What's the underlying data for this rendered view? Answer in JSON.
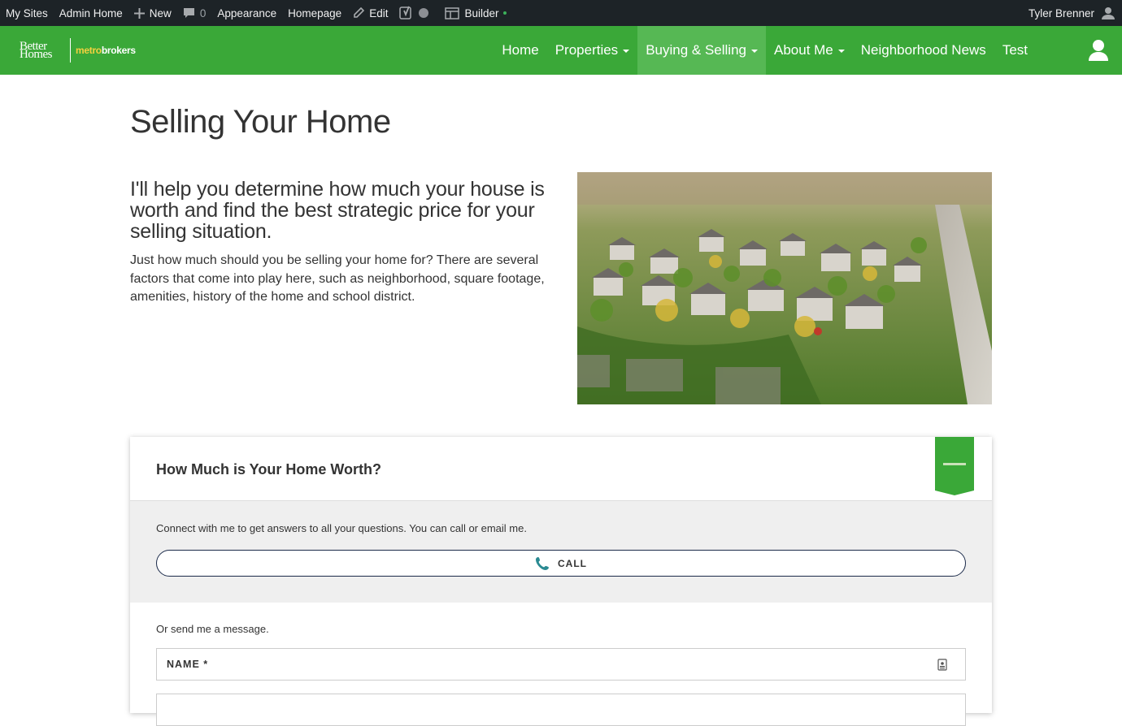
{
  "admin_bar": {
    "my_sites": "My Sites",
    "admin_home": "Admin Home",
    "new": "New",
    "comments_count": "0",
    "appearance": "Appearance",
    "homepage": "Homepage",
    "edit": "Edit",
    "builder": "Builder",
    "user_name": "Tyler Brenner"
  },
  "brand": {
    "logo_left_line1": "Better",
    "logo_left_line2": "Homes",
    "logo_right_pre": "metro",
    "logo_right_post": "brokers",
    "accent": "#3aa838"
  },
  "nav": {
    "items": [
      {
        "label": "Home",
        "dropdown": false,
        "active": false
      },
      {
        "label": "Properties",
        "dropdown": true,
        "active": false
      },
      {
        "label": "Buying & Selling",
        "dropdown": true,
        "active": true
      },
      {
        "label": "About Me",
        "dropdown": true,
        "active": false
      },
      {
        "label": "Neighborhood News",
        "dropdown": false,
        "active": false
      },
      {
        "label": "Test",
        "dropdown": false,
        "active": false
      }
    ]
  },
  "page": {
    "title": "Selling Your Home",
    "lead": "I'll help you determine how much your house is worth and find the best strategic price for your selling situation.",
    "body": "Just how much should you be selling your home for? There are several factors that come into play here, such as neighborhood, square footage, amenities, history of the home and school district."
  },
  "card": {
    "title": "How Much is Your Home Worth?",
    "connect_text": "Connect with me to get answers to all your questions. You can call or email me.",
    "call_label": "CALL",
    "or_message": "Or send me a message.",
    "name_label": "NAME *"
  }
}
